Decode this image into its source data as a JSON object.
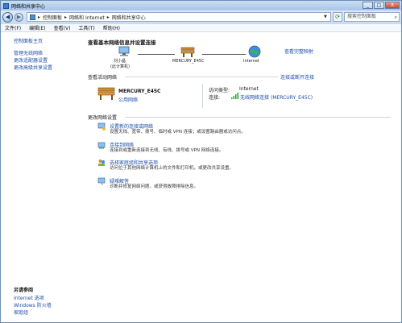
{
  "window": {
    "title": "网络和共享中心"
  },
  "titlebar_buttons": {
    "minimize": "_",
    "maximize": "□",
    "close": "X"
  },
  "address": {
    "segments": [
      "控制面板",
      "网络和 Internet",
      "网络和共享中心"
    ],
    "separator": "▸",
    "search_placeholder": "搜索控制面板"
  },
  "menu": [
    "文件(F)",
    "编辑(E)",
    "查看(V)",
    "工具(T)",
    "帮助(H)"
  ],
  "sidebar": {
    "home": "控制面板主页",
    "items": [
      "管理无线网络",
      "更改适配器设置",
      "更改高级共享设置"
    ],
    "see_also_title": "另请参阅",
    "see_also": [
      "Internet 选项",
      "Windows 防火墙",
      "家庭组"
    ]
  },
  "main": {
    "heading": "查看基本网络信息并设置连接",
    "full_map_link": "查看完整映射",
    "map": {
      "computer_name": "刘小晶",
      "computer_sub": "(此计算机)",
      "router_name": "MERCURY_E45C",
      "internet_name": "Internet"
    },
    "active_label": "查看活动网络",
    "connect_link": "连接或断开连接",
    "network": {
      "name": "MERCURY_E45C",
      "type_link": "公用网络",
      "access_type_label": "访问类型:",
      "access_type_value": "Internet",
      "connection_label": "连接:",
      "connection_value": "无线网络连接 (MERCURY_E45C)"
    },
    "change_label": "更改网络设置",
    "tasks": [
      {
        "title": "设置新的连接或网络",
        "desc": "设置无线、宽带、拨号、临时或 VPN 连接；或设置路由器或访问点。"
      },
      {
        "title": "连接到网络",
        "desc": "连接到或重新连接到无线、有线、拨号或 VPN 网络连接。"
      },
      {
        "title": "选择家庭组和共享选项",
        "desc": "访问位于其他网络计算机上的文件和打印机，或更改共享设置。"
      },
      {
        "title": "疑难解答",
        "desc": "诊断并修复网络问题，或获得故障排除信息。"
      }
    ]
  },
  "help_glyph": "?",
  "colors": {
    "link": "#1c4ea8",
    "titlebar": "#a7c5e8",
    "signal": "#2aa52a"
  }
}
